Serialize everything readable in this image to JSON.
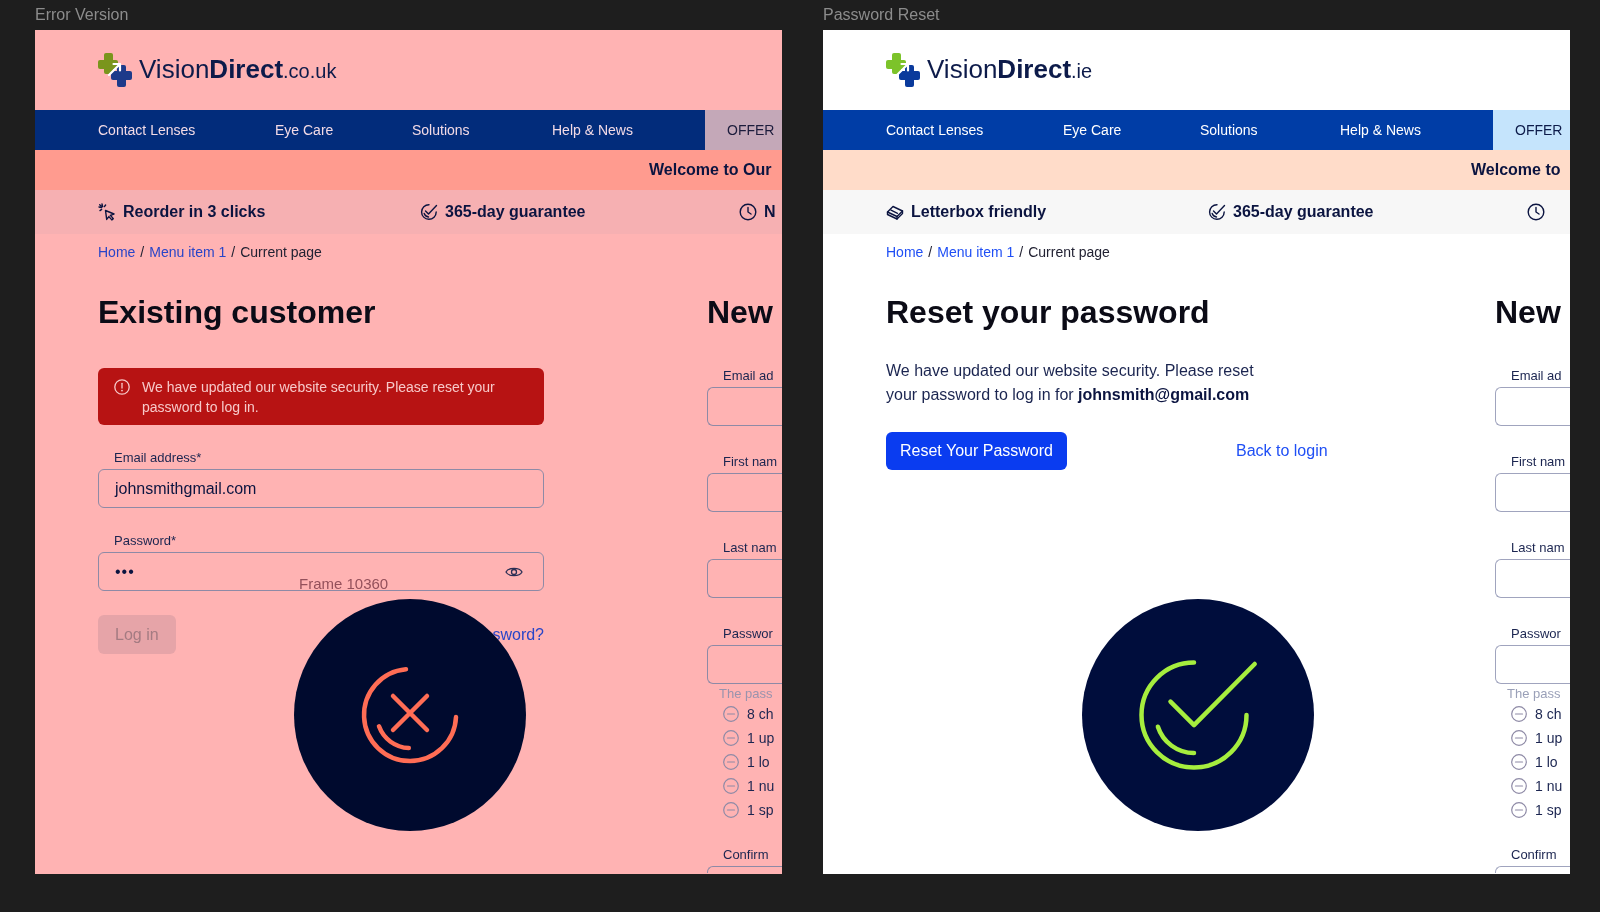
{
  "frames": [
    {
      "kind": "error",
      "title": "Error Version",
      "logo": {
        "name": "Vision",
        "brand": "Direct",
        "domain": ".co.uk"
      },
      "nav": {
        "items": [
          "Contact Lenses",
          "Eye Care",
          "Solutions",
          "Help & News"
        ],
        "offer": "OFFER"
      },
      "banner": "Welcome to Our",
      "benefits": [
        {
          "kind": "reorder",
          "label": "Reorder in 3 clicks"
        },
        {
          "kind": "guarantee",
          "label": "365-day guarantee"
        },
        {
          "kind": "delivery",
          "label": "N"
        }
      ],
      "breadcrumb": [
        {
          "kind": "link",
          "text": "Home"
        },
        {
          "kind": "separator",
          "text": "/"
        },
        {
          "kind": "link",
          "text": "Menu item 1"
        },
        {
          "kind": "separator",
          "text": "/"
        },
        {
          "kind": "current",
          "text": "Current page"
        }
      ],
      "main": {
        "kind": "login",
        "heading": "Existing customer",
        "alert": "We have updated our website security. Please reset your password to log in.",
        "fields": [
          {
            "kind": "email",
            "label": "Email address*",
            "value": "johnsmithgmail.com"
          },
          {
            "kind": "password",
            "label": "Password*",
            "value": "•••"
          }
        ],
        "button": {
          "label": "Log in",
          "disabled": true
        },
        "link": "sword?"
      },
      "register": {
        "heading": "New",
        "fields": [
          {
            "label": "Email ad"
          },
          {
            "label": "First nam"
          },
          {
            "label": "Last nam"
          },
          {
            "label": "Passwor"
          }
        ],
        "hint": "The pass",
        "rules": [
          {
            "text": "8 ch",
            "met": false
          },
          {
            "text": "1 up",
            "met": false
          },
          {
            "text": "1 lo",
            "met": false
          },
          {
            "text": "1 nu",
            "met": false
          },
          {
            "text": "1 sp",
            "met": false
          }
        ],
        "confirm": "Confirm"
      },
      "status": {
        "kind": "error",
        "caption": "Frame 10360"
      }
    },
    {
      "kind": "success",
      "title": "Password Reset",
      "logo": {
        "name": "Vision",
        "brand": "Direct",
        "domain": ".ie"
      },
      "nav": {
        "items": [
          "Contact Lenses",
          "Eye Care",
          "Solutions",
          "Help & News"
        ],
        "offer": "OFFER"
      },
      "banner": "Welcome to",
      "benefits": [
        {
          "kind": "letterbox",
          "label": "Letterbox friendly"
        },
        {
          "kind": "guarantee",
          "label": "365-day guarantee"
        },
        {
          "kind": "delivery"
        }
      ],
      "breadcrumb": [
        {
          "kind": "link",
          "text": "Home"
        },
        {
          "kind": "separator",
          "text": "/"
        },
        {
          "kind": "link",
          "text": "Menu item 1"
        },
        {
          "kind": "separator",
          "text": "/"
        },
        {
          "kind": "current",
          "text": "Current page"
        }
      ],
      "main": {
        "kind": "reset",
        "heading": "Reset your password",
        "message": "We have updated our website security. Please reset your password to log in for **johnsmith@gmail.com**",
        "button": {
          "label": "Reset Your Password",
          "disabled": false
        },
        "link": "Back to login"
      },
      "register": {
        "heading": "New",
        "fields": [
          {
            "label": "Email ad"
          },
          {
            "label": "First nam"
          },
          {
            "label": "Last nam"
          },
          {
            "label": "Passwor"
          }
        ],
        "hint": "The pass",
        "rules": [
          {
            "text": "8 ch",
            "met": false
          },
          {
            "text": "1 up",
            "met": false
          },
          {
            "text": "1 lo",
            "met": false
          },
          {
            "text": "1 nu",
            "met": false
          },
          {
            "text": "1 sp",
            "met": false
          }
        ],
        "confirm": "Confirm"
      },
      "status": {
        "kind": "success"
      }
    }
  ]
}
